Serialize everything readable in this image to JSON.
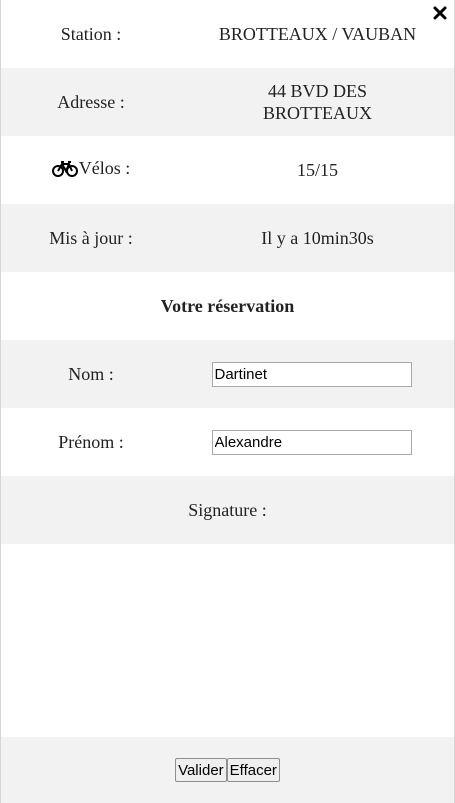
{
  "station": {
    "label": "Station :",
    "value": "BROTTEAUX / VAUBAN"
  },
  "address": {
    "label": "Adresse :",
    "value": "44 BVD DES BROTTEAUX"
  },
  "bikes": {
    "icon": "bicycle-icon",
    "label": "Vélos :",
    "value": "15/15"
  },
  "updated": {
    "label": "Mis à jour :",
    "value": "Il y a 10min30s"
  },
  "reservation": {
    "heading": "Votre réservation",
    "last_name": {
      "label": "Nom :",
      "value": "Dartinet"
    },
    "first_name": {
      "label": "Prénom :",
      "value": "Alexandre"
    },
    "signature_label": "Signature :"
  },
  "actions": {
    "validate_label": "Valider",
    "clear_label": "Effacer"
  },
  "close_icon": "close-icon"
}
